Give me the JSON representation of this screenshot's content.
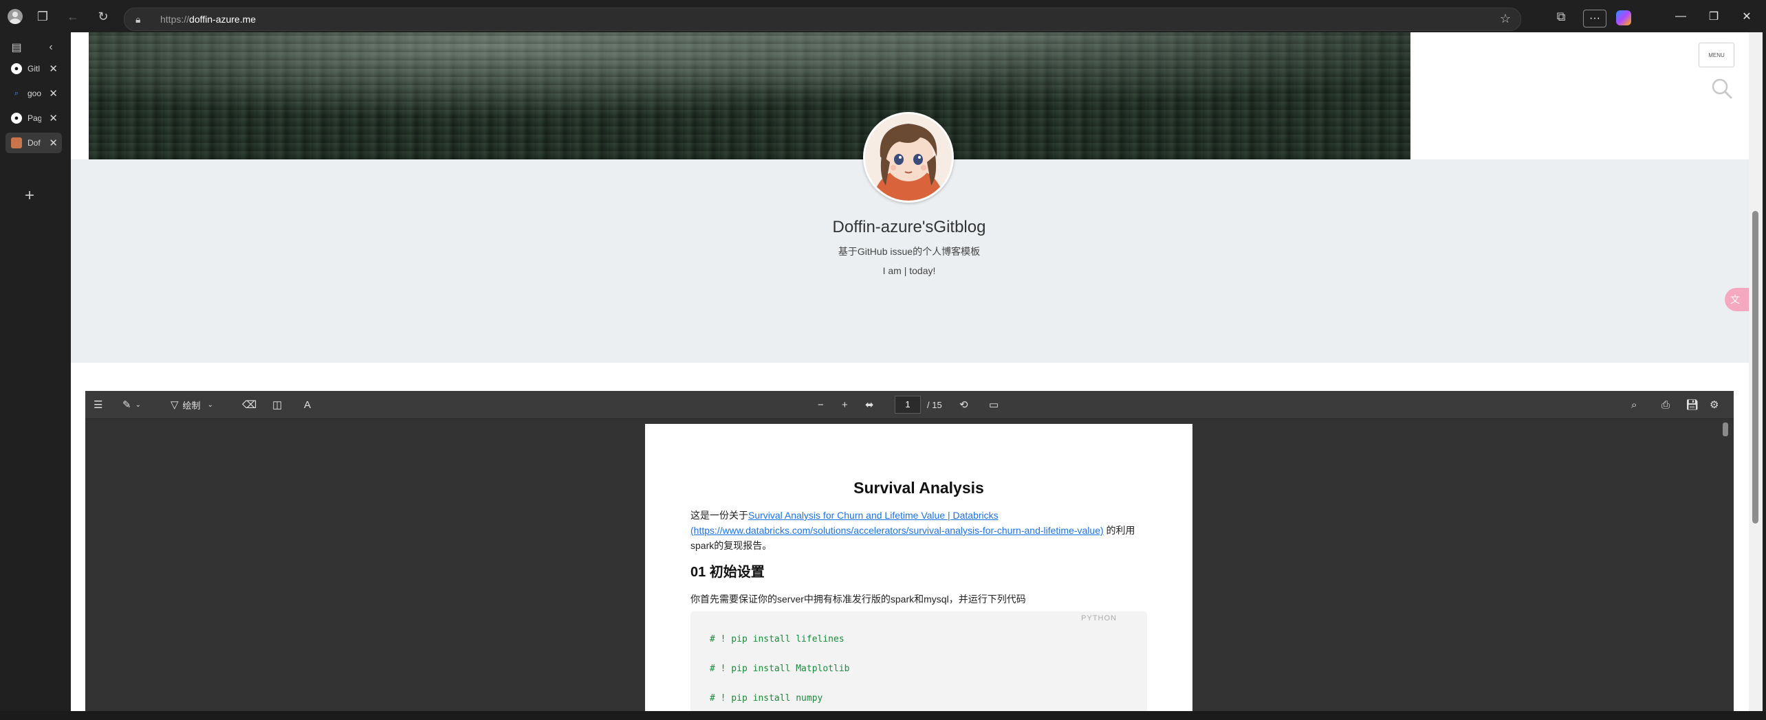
{
  "browser": {
    "url_scheme": "https://",
    "url_host": "doffin-azure.me",
    "more_label": "···"
  },
  "sidebar": {
    "tabs": [
      {
        "title": "Gitl",
        "icon": "github-icon"
      },
      {
        "title": "goo",
        "icon": "search-icon"
      },
      {
        "title": "Pag",
        "icon": "github-icon"
      },
      {
        "title": "Dof",
        "icon": "avatar-icon"
      }
    ],
    "new_tab_label": "+"
  },
  "page": {
    "menu_label": "MENU",
    "blog_title": "Doffin-azure'sGitblog",
    "blog_description": "基于GitHub issue的个人博客模板",
    "blog_motto": "I am | today!"
  },
  "pdf": {
    "draw_label": "绘制",
    "page_current": "1",
    "page_total": "/ 15",
    "doc_title": "Survival Analysis",
    "p1_prefix": "这是一份关于",
    "p1_link": "Survival Analysis for Churn and Lifetime Value | Databricks (https://www.databricks.com/solutions/accelerators/survival-analysis-for-churn-and-lifetime-value)",
    "p1_suffix": " 的利用spark的复现报告。",
    "h2": "01 初始设置",
    "p2": "你首先需要保证你的server中拥有标准发行版的spark和mysql，并运行下列代码",
    "code_lang": "PYTHON",
    "code_lines": [
      "# ! pip install lifelines",
      "# ! pip install Matplotlib",
      "# ! pip install numpy"
    ]
  }
}
